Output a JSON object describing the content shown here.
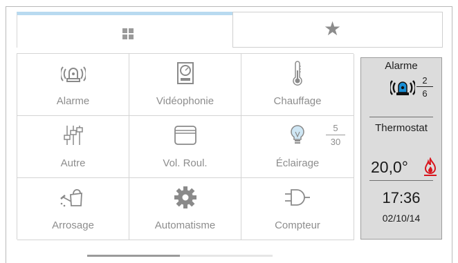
{
  "tabs": [
    {
      "icon": "grid-icon",
      "active": true
    },
    {
      "icon": "star-icon",
      "active": false
    }
  ],
  "tiles": [
    {
      "label": "Alarme",
      "icon": "alarm-siren-icon"
    },
    {
      "label": "Vidéophonie",
      "icon": "intercom-icon"
    },
    {
      "label": "Chauffage",
      "icon": "thermometer-icon"
    },
    {
      "label": "Autre",
      "icon": "sliders-icon"
    },
    {
      "label": "Vol. Roul.",
      "icon": "roller-shutter-icon"
    },
    {
      "label": "Éclairage",
      "icon": "light-bulb-icon",
      "count": "5",
      "total": "30"
    },
    {
      "label": "Arrosage",
      "icon": "watering-can-icon"
    },
    {
      "label": "Automatisme",
      "icon": "gear-icon"
    },
    {
      "label": "Compteur",
      "icon": "plug-meter-icon"
    }
  ],
  "status": {
    "alarm_title": "Alarme",
    "alarm_count": "2",
    "alarm_total": "6",
    "thermostat_title": "Thermostat",
    "temperature": "20,0°",
    "time": "17:36",
    "date": "02/10/14"
  },
  "colors": {
    "tab_active_accent": "#b8daf0",
    "alarm_siren": "#1a8fd6",
    "flame": "#d8141c",
    "panel_bg": "#dcdcdc"
  },
  "pager": {
    "fraction": 0.5
  }
}
